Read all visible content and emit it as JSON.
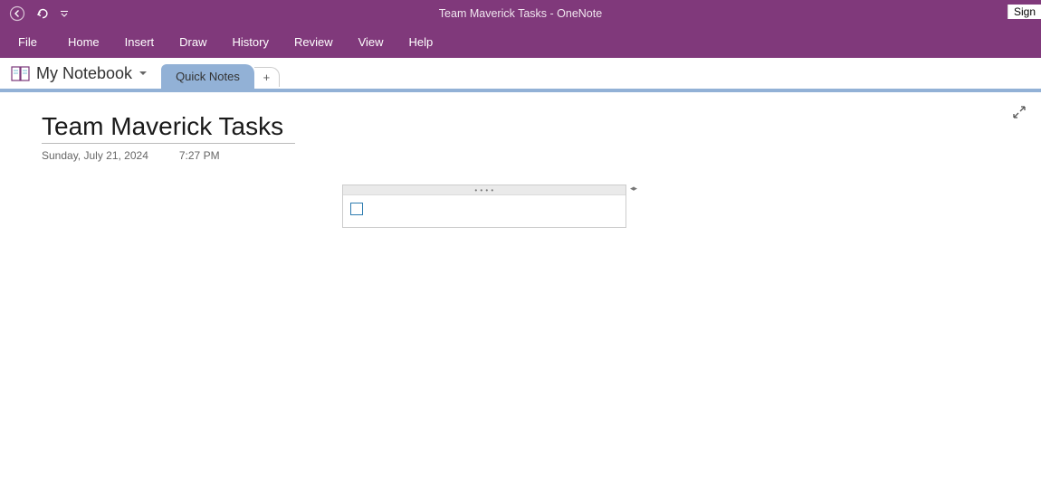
{
  "window": {
    "title": "Team Maverick Tasks  -  OneNote"
  },
  "titlebar": {
    "sign_in": "Sign"
  },
  "menu": {
    "items": [
      "File",
      "Home",
      "Insert",
      "Draw",
      "History",
      "Review",
      "View",
      "Help"
    ]
  },
  "notebook": {
    "name": "My Notebook"
  },
  "tabs": {
    "active": "Quick Notes",
    "add_label": "+"
  },
  "page": {
    "title": "Team Maverick Tasks",
    "date": "Sunday, July 21, 2024",
    "time": "7:27 PM"
  }
}
